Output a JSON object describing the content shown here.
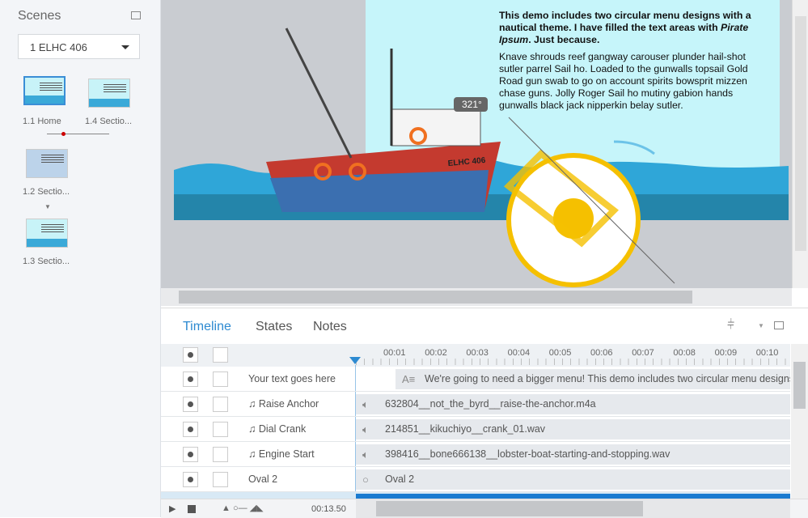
{
  "scenes": {
    "title": "Scenes",
    "dropdown": "1 ELHC 406",
    "slides": [
      {
        "label": "1.1 Home"
      },
      {
        "label": "1.4 Sectio..."
      },
      {
        "label": "1.2 Sectio..."
      },
      {
        "label": "1.3 Sectio..."
      }
    ]
  },
  "slide": {
    "intro_pre": "This demo includes two circular menu designs with a nautical theme. I have filled the text areas with ",
    "intro_em": "Pirate Ipsum",
    "intro_post": ". Just because.",
    "body": "Knave shrouds reef gangway carouser plunder hail-shot sutler parrel Sail ho. Loaded to the gunwalls topsail Gold Road gun swab to go on account spirits bowsprit mizzen chase guns. Jolly Roger Sail ho mutiny gabion hands gunwalls black jack nipperkin belay sutler.",
    "boat_name": "ELHC 406",
    "rotation": "321°"
  },
  "timeline": {
    "tabs": [
      "Timeline",
      "States",
      "Notes"
    ],
    "ticks": [
      "00:01",
      "00:02",
      "00:03",
      "00:04",
      "00:05",
      "00:06",
      "00:07",
      "00:08",
      "00:09",
      "00:10"
    ],
    "rows": [
      {
        "name": "Your text goes here",
        "track": "We're going to need a bigger menu! This demo includes two circular menu designs"
      },
      {
        "name": "♫ Raise Anchor",
        "track": "632804__not_the_byrd__raise-the-anchor.m4a"
      },
      {
        "name": "♫ Dial Crank",
        "track": "214851__kikuchiyo__crank_01.wav"
      },
      {
        "name": "♫ Engine Start",
        "track": "398416__bone666138__lobster-boat-starting-and-stopping.wav"
      },
      {
        "name": "Oval 2",
        "track": "Oval 2"
      }
    ],
    "time": "00:13.50"
  },
  "colors": {
    "accent": "#2d8ad1",
    "slide": "#c6f5fa",
    "ring": "#f5c000"
  }
}
